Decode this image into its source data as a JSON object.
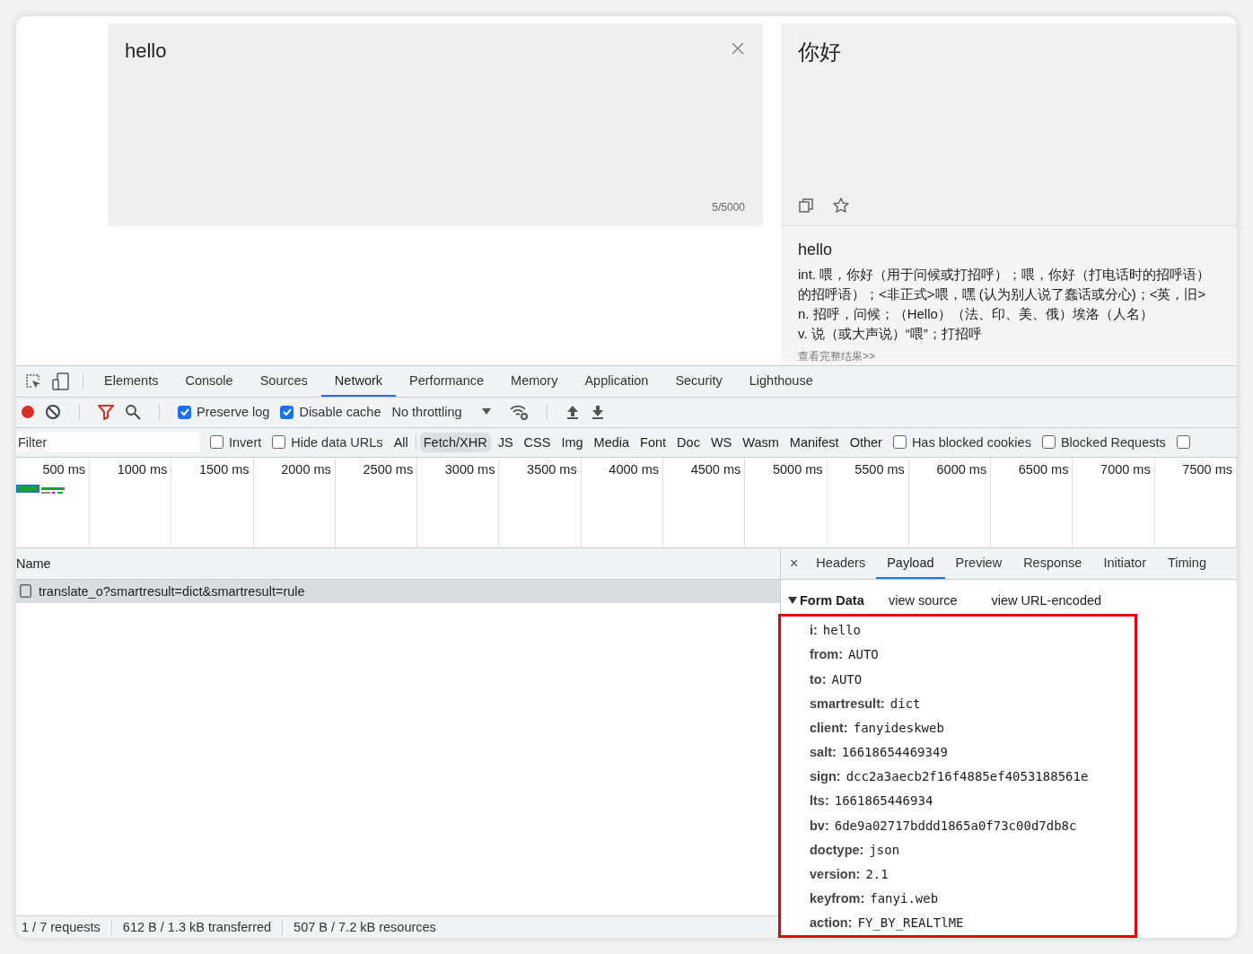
{
  "translator": {
    "input_text": "hello",
    "char_count": "5/5000",
    "translation": "你好",
    "dict": {
      "headword": "hello",
      "definitions": [
        "int. 喂，你好（用于问候或打招呼）；喂，你好（打电话时的招呼语）",
        "的招呼语）；<非正式>喂，嘿 (认为别人说了蠢话或分心)；<英，旧>",
        "n. 招呼，问候；（Hello）（法、印、美、俄）埃洛（人名）",
        "v. 说（或大声说）“喂”；打招呼"
      ],
      "more_link": "查看完整结果>>"
    }
  },
  "devtools": {
    "tabs": [
      {
        "label": "Elements",
        "selected": false
      },
      {
        "label": "Console",
        "selected": false
      },
      {
        "label": "Sources",
        "selected": false
      },
      {
        "label": "Network",
        "selected": true
      },
      {
        "label": "Performance",
        "selected": false
      },
      {
        "label": "Memory",
        "selected": false
      },
      {
        "label": "Application",
        "selected": false
      },
      {
        "label": "Security",
        "selected": false
      },
      {
        "label": "Lighthouse",
        "selected": false
      }
    ],
    "toolbar": {
      "recording": true,
      "options": [
        {
          "label": "Preserve log",
          "checked": true
        },
        {
          "label": "Disable cache",
          "checked": true
        }
      ],
      "throttling": "No throttling"
    },
    "filter": {
      "placeholder": "Filter",
      "checkboxes": [
        {
          "label": "Invert",
          "checked": false
        },
        {
          "label": "Hide data URLs",
          "checked": false
        }
      ],
      "types": [
        {
          "label": "All",
          "selected": false
        },
        {
          "label": "Fetch/XHR",
          "selected": true
        },
        {
          "label": "JS",
          "selected": false
        },
        {
          "label": "CSS",
          "selected": false
        },
        {
          "label": "Img",
          "selected": false
        },
        {
          "label": "Media",
          "selected": false
        },
        {
          "label": "Font",
          "selected": false
        },
        {
          "label": "Doc",
          "selected": false
        },
        {
          "label": "WS",
          "selected": false
        },
        {
          "label": "Wasm",
          "selected": false
        },
        {
          "label": "Manifest",
          "selected": false
        },
        {
          "label": "Other",
          "selected": false
        }
      ],
      "more_checkboxes": [
        {
          "label": "Has blocked cookies",
          "checked": false
        },
        {
          "label": "Blocked Requests",
          "checked": false
        },
        {
          "checked": false
        }
      ]
    },
    "timeline": {
      "ticks": [
        "500 ms",
        "1000 ms",
        "1500 ms",
        "2000 ms",
        "2500 ms",
        "3000 ms",
        "3500 ms",
        "4000 ms",
        "4500 ms",
        "5000 ms",
        "5500 ms",
        "6000 ms",
        "6500 ms",
        "7000 ms",
        "7500 ms"
      ]
    },
    "requests": {
      "column": "Name",
      "rows": [
        {
          "name": "translate_o?smartresult=dict&smartresult=rule",
          "selected": true
        }
      ]
    },
    "details": {
      "close": "×",
      "tabs": [
        {
          "label": "Headers",
          "selected": false
        },
        {
          "label": "Payload",
          "selected": true
        },
        {
          "label": "Preview",
          "selected": false
        },
        {
          "label": "Response",
          "selected": false
        },
        {
          "label": "Initiator",
          "selected": false
        },
        {
          "label": "Timing",
          "selected": false
        }
      ],
      "section": {
        "title": "Form Data",
        "expanded": true,
        "links": [
          "view source",
          "view URL-encoded"
        ],
        "fields": [
          {
            "key": "i:",
            "value": "hello"
          },
          {
            "key": "from:",
            "value": "AUTO"
          },
          {
            "key": "to:",
            "value": "AUTO"
          },
          {
            "key": "smartresult:",
            "value": "dict"
          },
          {
            "key": "client:",
            "value": "fanyideskweb"
          },
          {
            "key": "salt:",
            "value": "16618654469349"
          },
          {
            "key": "sign:",
            "value": "dcc2a3aecb2f16f4885ef4053188561e"
          },
          {
            "key": "lts:",
            "value": "1661865446934"
          },
          {
            "key": "bv:",
            "value": "6de9a02717bddd1865a0f73c00d7db8c"
          },
          {
            "key": "doctype:",
            "value": "json"
          },
          {
            "key": "version:",
            "value": "2.1"
          },
          {
            "key": "keyfrom:",
            "value": "fanyi.web"
          },
          {
            "key": "action:",
            "value": "FY_BY_REALTlME"
          }
        ]
      }
    },
    "status": [
      "1 / 7 requests",
      "612 B / 1.3 kB transferred",
      "507 B / 7.2 kB resources"
    ]
  }
}
